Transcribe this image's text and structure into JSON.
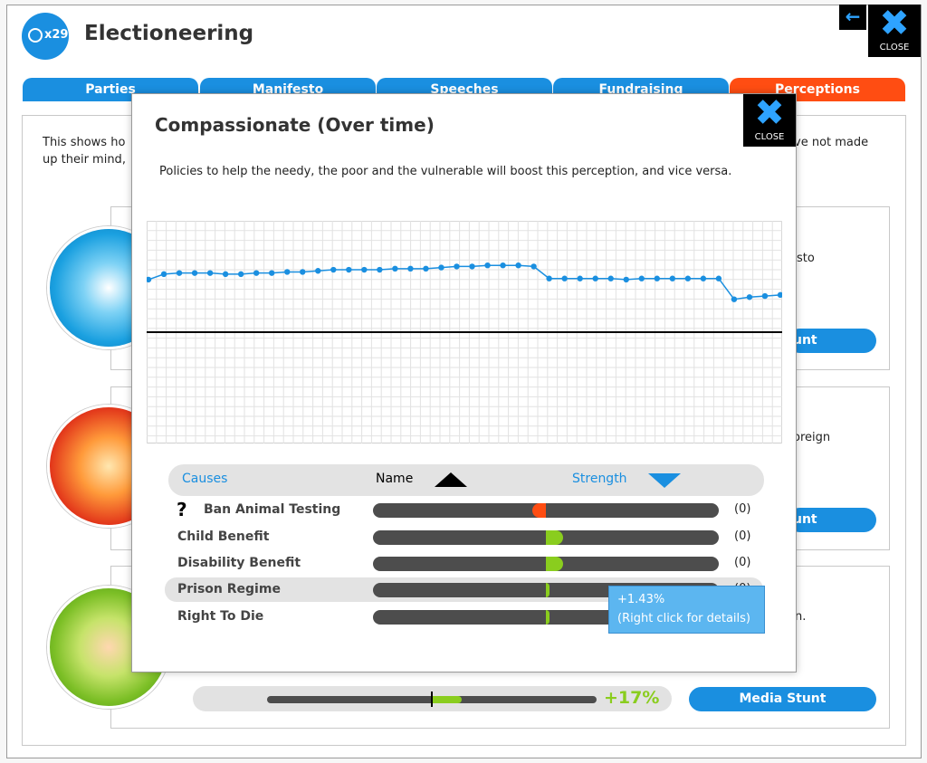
{
  "app": {
    "title": "Electioneering",
    "badge_count": "x29",
    "back_icon": "back-arrow-icon",
    "close_label": "CLOSE"
  },
  "tabs": [
    {
      "label": "Parties",
      "active": false
    },
    {
      "label": "Manifesto",
      "active": false
    },
    {
      "label": "Speeches",
      "active": false
    },
    {
      "label": "Fundraising",
      "active": false
    },
    {
      "label": "Perceptions",
      "active": true
    }
  ],
  "background": {
    "intro_line1": "This shows ho",
    "intro_line1_end": "ve not made",
    "intro_line2": "up their mind,",
    "cards": [
      {
        "text": "sto",
        "button": "unt"
      },
      {
        "text": "oreign",
        "button": "unt"
      },
      {
        "text": "n.",
        "button": "Media Stunt",
        "meter_value_pct": "+17%",
        "meter_fill": 0.09,
        "meter_mark": 0.5
      }
    ]
  },
  "dialog": {
    "title": "Compassionate (Over time)",
    "close_label": "CLOSE",
    "description": "Policies to help the needy, the poor and the vulnerable will boost this perception, and vice versa.",
    "table_header": {
      "causes": "Causes",
      "name": "Name",
      "strength": "Strength"
    },
    "causes": [
      {
        "name": "Ban Animal Testing",
        "effect": -0.04,
        "count": "(0)",
        "unknown": true,
        "highlight": false
      },
      {
        "name": "Child Benefit",
        "effect": 0.05,
        "count": "(0)",
        "unknown": false,
        "highlight": false
      },
      {
        "name": "Disability Benefit",
        "effect": 0.05,
        "count": "(0)",
        "unknown": false,
        "highlight": false
      },
      {
        "name": "Prison Regime",
        "effect": 0.01,
        "count": "(0)",
        "unknown": false,
        "highlight": true
      },
      {
        "name": "Right To Die",
        "effect": 0.01,
        "count": "(0)",
        "unknown": false,
        "highlight": false
      }
    ],
    "unknown_marker": "?",
    "tooltip": {
      "line1": "+1.43%",
      "line2": "(Right click for details)"
    }
  },
  "chart_data": {
    "type": "line",
    "ylim": [
      -1,
      1
    ],
    "baseline": 0,
    "grid": true,
    "color": "#1a8fe0",
    "series": [
      {
        "values": [
          0.48,
          0.53,
          0.54,
          0.54,
          0.54,
          0.53,
          0.53,
          0.54,
          0.54,
          0.55,
          0.55,
          0.56,
          0.57,
          0.57,
          0.57,
          0.57,
          0.58,
          0.58,
          0.58,
          0.59,
          0.6,
          0.6,
          0.61,
          0.61,
          0.61,
          0.6,
          0.49,
          0.49,
          0.49,
          0.49,
          0.49,
          0.48,
          0.49,
          0.49,
          0.49,
          0.49,
          0.49,
          0.49,
          0.3,
          0.32,
          0.33,
          0.34
        ]
      }
    ]
  }
}
